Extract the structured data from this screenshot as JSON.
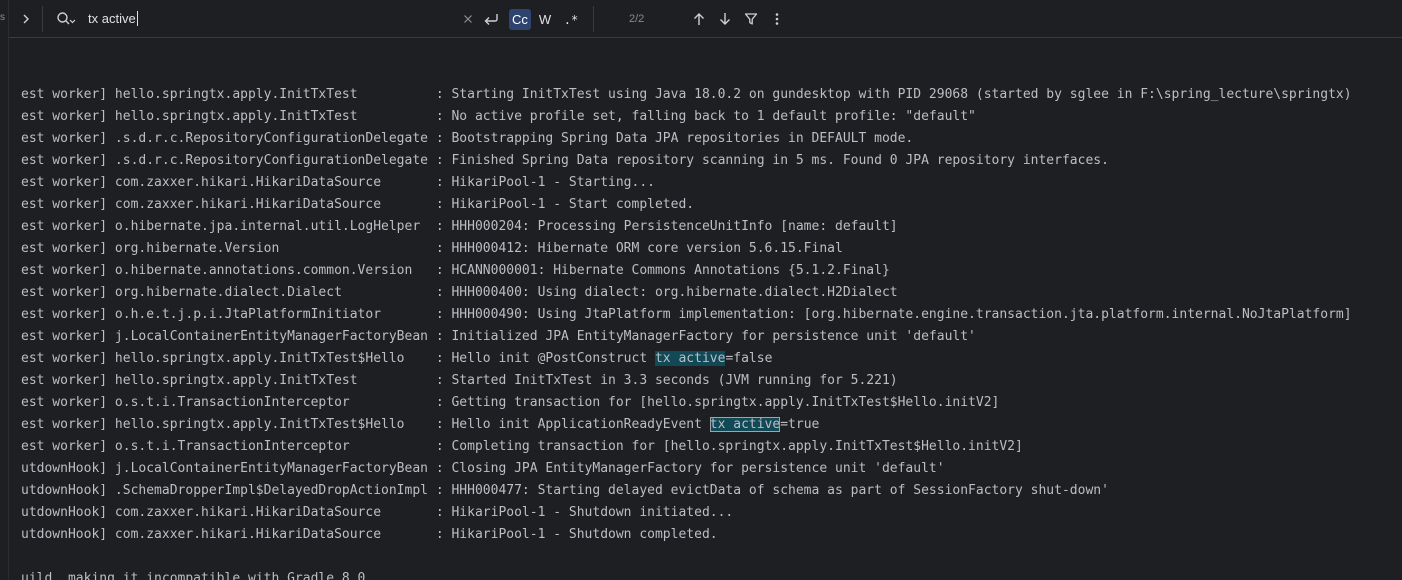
{
  "gutter": {
    "mark": "s"
  },
  "search": {
    "query": "tx active",
    "match_count": "2/2",
    "options": {
      "case_label": "Cc",
      "word_label": "W",
      "regex_label": ".*"
    },
    "icons": {
      "expand": "chevron-right-icon",
      "search": "search-history-icon",
      "clear": "close-icon",
      "newline": "new-line-icon",
      "prev": "arrow-up-icon",
      "next": "arrow-down-icon",
      "filter": "filter-icon",
      "more": "more-vertical-icon"
    }
  },
  "console": {
    "lines": [
      {
        "thread": "est worker]",
        "logger": "hello.springtx.apply.InitTxTest         ",
        "msg": "Starting InitTxTest using Java 18.0.2 on gundesktop with PID 29068 (started by sglee in F:\\spring_lecture\\springtx)"
      },
      {
        "thread": "est worker]",
        "logger": "hello.springtx.apply.InitTxTest         ",
        "msg": "No active profile set, falling back to 1 default profile: \"default\""
      },
      {
        "thread": "est worker]",
        "logger": ".s.d.r.c.RepositoryConfigurationDelegate",
        "msg": "Bootstrapping Spring Data JPA repositories in DEFAULT mode."
      },
      {
        "thread": "est worker]",
        "logger": ".s.d.r.c.RepositoryConfigurationDelegate",
        "msg": "Finished Spring Data repository scanning in 5 ms. Found 0 JPA repository interfaces."
      },
      {
        "thread": "est worker]",
        "logger": "com.zaxxer.hikari.HikariDataSource      ",
        "msg": "HikariPool-1 - Starting..."
      },
      {
        "thread": "est worker]",
        "logger": "com.zaxxer.hikari.HikariDataSource      ",
        "msg": "HikariPool-1 - Start completed."
      },
      {
        "thread": "est worker]",
        "logger": "o.hibernate.jpa.internal.util.LogHelper ",
        "msg": "HHH000204: Processing PersistenceUnitInfo [name: default]"
      },
      {
        "thread": "est worker]",
        "logger": "org.hibernate.Version                   ",
        "msg": "HHH000412: Hibernate ORM core version 5.6.15.Final"
      },
      {
        "thread": "est worker]",
        "logger": "o.hibernate.annotations.common.Version  ",
        "msg": "HCANN000001: Hibernate Commons Annotations {5.1.2.Final}"
      },
      {
        "thread": "est worker]",
        "logger": "org.hibernate.dialect.Dialect           ",
        "msg": "HHH000400: Using dialect: org.hibernate.dialect.H2Dialect"
      },
      {
        "thread": "est worker]",
        "logger": "o.h.e.t.j.p.i.JtaPlatformInitiator      ",
        "msg": "HHH000490: Using JtaPlatform implementation: [org.hibernate.engine.transaction.jta.platform.internal.NoJtaPlatform]"
      },
      {
        "thread": "est worker]",
        "logger": "j.LocalContainerEntityManagerFactoryBean",
        "msg": "Initialized JPA EntityManagerFactory for persistence unit 'default'"
      },
      {
        "thread": "est worker]",
        "logger": "hello.springtx.apply.InitTxTest$Hello   ",
        "msg_pre": "Hello init @PostConstruct ",
        "match": "tx active",
        "msg_post": "=false",
        "current": false
      },
      {
        "thread": "est worker]",
        "logger": "hello.springtx.apply.InitTxTest         ",
        "msg": "Started InitTxTest in 3.3 seconds (JVM running for 5.221)"
      },
      {
        "thread": "est worker]",
        "logger": "o.s.t.i.TransactionInterceptor          ",
        "msg": "Getting transaction for [hello.springtx.apply.InitTxTest$Hello.initV2]"
      },
      {
        "thread": "est worker]",
        "logger": "hello.springtx.apply.InitTxTest$Hello   ",
        "msg_pre": "Hello init ApplicationReadyEvent ",
        "match": "tx active",
        "msg_post": "=true",
        "current": true
      },
      {
        "thread": "est worker]",
        "logger": "o.s.t.i.TransactionInterceptor          ",
        "msg": "Completing transaction for [hello.springtx.apply.InitTxTest$Hello.initV2]"
      },
      {
        "thread": "utdownHook]",
        "logger": "j.LocalContainerEntityManagerFactoryBean",
        "msg": "Closing JPA EntityManagerFactory for persistence unit 'default'"
      },
      {
        "thread": "utdownHook]",
        "logger": ".SchemaDropperImpl$DelayedDropActionImpl",
        "msg": "HHH000477: Starting delayed evictData of schema as part of SessionFactory shut-down'"
      },
      {
        "thread": "utdownHook]",
        "logger": "com.zaxxer.hikari.HikariDataSource      ",
        "msg": "HikariPool-1 - Shutdown initiated..."
      },
      {
        "thread": "utdownHook]",
        "logger": "com.zaxxer.hikari.HikariDataSource      ",
        "msg": "HikariPool-1 - Shutdown completed."
      }
    ],
    "tail_line": "uild, making it incompatible with Gradle 8.0."
  }
}
